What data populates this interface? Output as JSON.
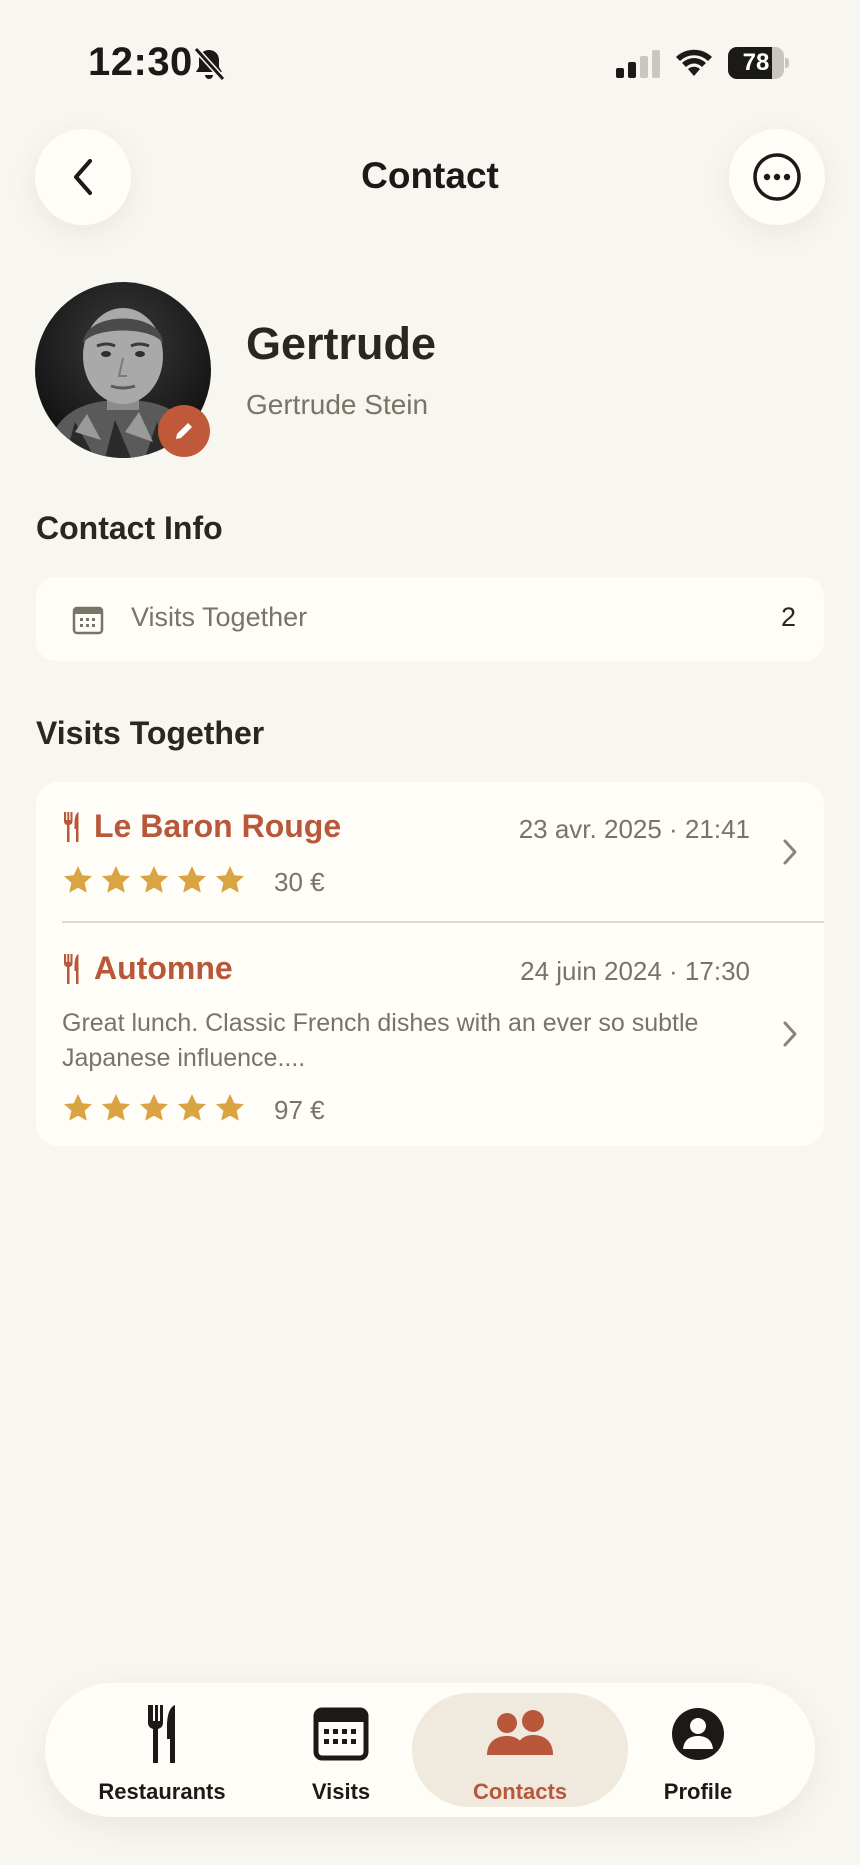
{
  "status_bar": {
    "time": "12:30",
    "battery": "78",
    "battery_level": 0.78
  },
  "header": {
    "title": "Contact"
  },
  "contact": {
    "nickname": "Gertrude",
    "full_name": "Gertrude Stein"
  },
  "contact_info": {
    "section_title": "Contact Info",
    "rows": [
      {
        "icon": "calendar-icon",
        "label": "Visits Together",
        "value": "2"
      }
    ]
  },
  "visits": {
    "section_title": "Visits Together",
    "items": [
      {
        "restaurant": "Le Baron Rouge",
        "date": "23 avr. 2025 · 21:41",
        "note": "",
        "rating": 5,
        "price": "30 €"
      },
      {
        "restaurant": "Automne",
        "date": "24 juin 2024 · 17:30",
        "note": "Great lunch. Classic French dishes with an ever so subtle Japanese influence....",
        "rating": 5,
        "price": "97 €"
      }
    ]
  },
  "tab_bar": {
    "tabs": [
      {
        "label": "Restaurants",
        "icon": "fork-knife-icon",
        "active": false
      },
      {
        "label": "Visits",
        "icon": "calendar-icon",
        "active": false
      },
      {
        "label": "Contacts",
        "icon": "people-icon",
        "active": true
      },
      {
        "label": "Profile",
        "icon": "person-circle-icon",
        "active": false
      }
    ]
  },
  "colors": {
    "accent": "#b8573a",
    "star": "#dba443",
    "background": "#f8f6f0",
    "card": "#fffdf8"
  }
}
